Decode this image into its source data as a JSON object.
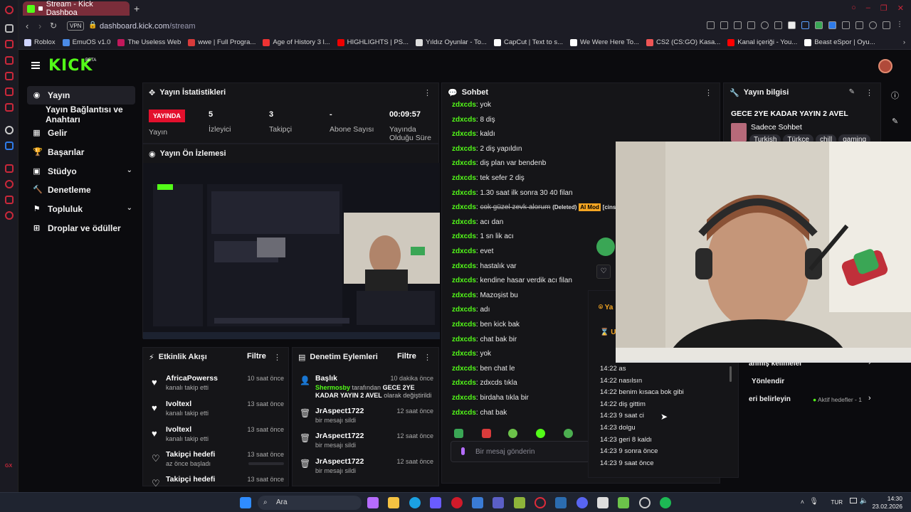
{
  "browser": {
    "tab_title": "Stream - Kick Dashboa",
    "url_domain": "dashboard.kick.com",
    "url_path": "/stream",
    "vpn_label": "VPN",
    "bookmarks": [
      "Roblox",
      "EmuOS v1.0",
      "The Useless Web",
      "wwe | Full Progra...",
      "Age of History 3 l...",
      "HIGHLIGHTS | PS...",
      "Yıldız Oyunlar - To...",
      "CapCut | Text to s...",
      "We Were Here To...",
      "CS2 (CS:GO) Kasa...",
      "Kanal içeriği - You...",
      "Beast eSpor | Oyu..."
    ],
    "bookmark_colors": [
      "#cfd4ff",
      "#4b8be6",
      "#c2185b",
      "#d93b3b",
      "#e33",
      "#e00",
      "#ddd",
      "#fff",
      "#fff",
      "#e55",
      "#f00",
      "#fff"
    ]
  },
  "kick": {
    "logo": "KICK",
    "beta": "BETA"
  },
  "nav": {
    "items": [
      {
        "label": "Yayın",
        "icon": "broadcast-icon",
        "glyph": "((·))",
        "active": true
      },
      {
        "label": "Yayın Bağlantısı ve Anahtarı",
        "icon": "",
        "glyph": "",
        "active": false
      },
      {
        "label": "Gelir",
        "icon": "revenue-icon",
        "glyph": "▦",
        "active": false
      },
      {
        "label": "Başarılar",
        "icon": "trophy-icon",
        "glyph": "🏆",
        "active": false
      },
      {
        "label": "Stüdyo",
        "icon": "studio-icon",
        "glyph": "▣",
        "active": false,
        "chevron": true
      },
      {
        "label": "Denetleme",
        "icon": "hammer-icon",
        "glyph": "🔨",
        "active": false
      },
      {
        "label": "Topluluk",
        "icon": "community-icon",
        "glyph": "⚑",
        "active": false,
        "chevron": true
      },
      {
        "label": "Droplar ve ödüller",
        "icon": "drops-icon",
        "glyph": "⊞",
        "active": false
      }
    ]
  },
  "stats": {
    "title": "Yayın İstatistikleri",
    "live_badge": "YAYINDA",
    "live_label": "Yayın",
    "viewers_value": "5",
    "viewers_label": "İzleyici",
    "followers_value": "3",
    "followers_label": "Takipçi",
    "subs_value": "-",
    "subs_label": "Abone Sayısı",
    "duration_value": "00:09:57",
    "duration_label_1": "Yayında",
    "duration_label_2": "Olduğu Süre"
  },
  "preview": {
    "title": "Yayın Ön İzlemesi"
  },
  "activity": {
    "title": "Etkinlik Akışı",
    "filter": "Filtre",
    "rows": [
      {
        "name": "AfricaPowerss",
        "sub": "kanalı takip etti",
        "time": "10 saat önce"
      },
      {
        "name": "Ivoltexl",
        "sub": "kanalı takip etti",
        "time": "13 saat önce"
      },
      {
        "name": "Ivoltexl",
        "sub": "kanalı takip etti",
        "time": "13 saat önce"
      },
      {
        "name": "Takipçi hedefi",
        "sub": "az önce başladı",
        "time": "13 saat önce"
      },
      {
        "name": "Takipçi hedefi",
        "sub": "",
        "time": "13 saat önce"
      }
    ]
  },
  "moderation": {
    "title": "Denetim Eylemleri",
    "filter": "Filtre",
    "first": {
      "name": "Başlık",
      "time": "10 dakika önce",
      "user": "Shermosby",
      "mid": " tarafından ",
      "value": "GECE 2YE KADAR YAYIN 2 AVEL",
      "end": " olarak değiştirildi"
    },
    "rows": [
      {
        "name": "JrAspect1722",
        "sub": "bir mesajı sildi",
        "time": "12 saat önce"
      },
      {
        "name": "JrAspect1722",
        "sub": "bir mesajı sildi",
        "time": "12 saat önce"
      },
      {
        "name": "JrAspect1722",
        "sub": "bir mesajı sildi",
        "time": "12 saat önce"
      }
    ]
  },
  "chat": {
    "title": "Sohbet",
    "user": "zdxcds",
    "messages": [
      "yok",
      "8 diş",
      "kaldı",
      "2 diş yapıldın",
      "diş plan var bendenb",
      "tek sefer 2 diş",
      "1.30 saat ilk sonra 30 40 filan",
      "__deleted__",
      "acı dan",
      "1 sn lik acı",
      "evet",
      "hastalık var",
      "kendine hasar verdik acı filan",
      "Mazoşist bu",
      "adı",
      "ben kick bak",
      "chat bak bir",
      "yok",
      "ben chat le",
      "zdxcds tıkla",
      "birdaha tıkla bir",
      "chat bak"
    ],
    "deleted_text": "cok güzel zevk alorum",
    "deleted_tag": "(Deleted)",
    "ai_mod": "AI Mod",
    "cut_text": "[cinsellik",
    "input_placeholder": "Bir mesaj gönderin"
  },
  "stream_info": {
    "title": "Yayın bilgisi",
    "stream_title": "GECE 2YE KADAR YAYIN 2 AVEL",
    "category": "Sadece Sohbet",
    "tags": [
      "Turkish",
      "Türkçe",
      "chill",
      "gaming"
    ]
  },
  "right_fragments": {
    "ya": "Ya",
    "uz": "Uz",
    "kelimeler": "anmış kelimeler",
    "yonlendir": "Yönlendir",
    "belirleyin": "eri belirleyin",
    "aktif": "Aktif hedefler - 1"
  },
  "timestamps": [
    {
      "time": "14:22",
      "text": "as"
    },
    {
      "time": "14:22",
      "text": "nasılsın"
    },
    {
      "time": "14:22",
      "text": "benim kısaca bok gibi"
    },
    {
      "time": "14:22",
      "text": "diş gittim"
    },
    {
      "time": "14:23",
      "text": "9 saat ci"
    },
    {
      "time": "14:23",
      "text": "dolgu"
    },
    {
      "time": "14:23",
      "text": "geri 8 kaldı"
    },
    {
      "time": "14:23",
      "text": "9 sonra önce"
    },
    {
      "time": "14:23",
      "text": "9 saat önce"
    }
  ],
  "taskbar": {
    "search": "Ara",
    "lang": "TUR",
    "time": "14:30",
    "date": "23.02.2026"
  },
  "side_label": "GX"
}
